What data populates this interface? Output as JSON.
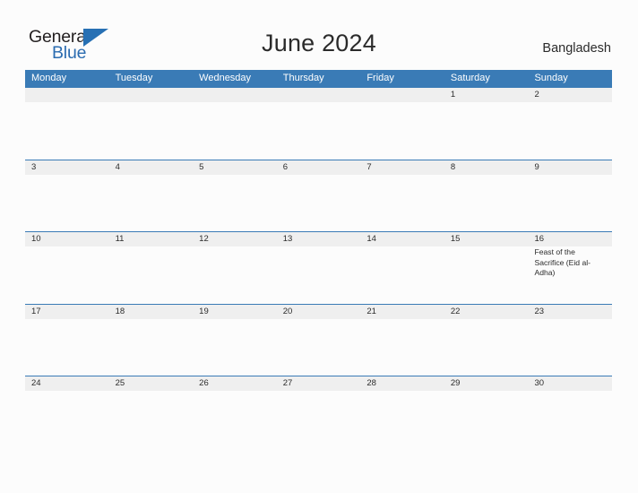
{
  "header": {
    "logo": {
      "text_primary": "General",
      "text_secondary": "Blue",
      "triangle_icon": "triangle-icon",
      "primary_color": "#231f20",
      "secondary_color": "#2b6cb0",
      "triangle_color": "#2770b4"
    },
    "title": "June 2024",
    "region": "Bangladesh"
  },
  "calendar": {
    "accent_color": "#3a7bb6",
    "date_band_color": "#efefef",
    "weekdays": [
      "Monday",
      "Tuesday",
      "Wednesday",
      "Thursday",
      "Friday",
      "Saturday",
      "Sunday"
    ],
    "weeks": [
      {
        "days": [
          {
            "date": "",
            "event": ""
          },
          {
            "date": "",
            "event": ""
          },
          {
            "date": "",
            "event": ""
          },
          {
            "date": "",
            "event": ""
          },
          {
            "date": "",
            "event": ""
          },
          {
            "date": "1",
            "event": ""
          },
          {
            "date": "2",
            "event": ""
          }
        ]
      },
      {
        "days": [
          {
            "date": "3",
            "event": ""
          },
          {
            "date": "4",
            "event": ""
          },
          {
            "date": "5",
            "event": ""
          },
          {
            "date": "6",
            "event": ""
          },
          {
            "date": "7",
            "event": ""
          },
          {
            "date": "8",
            "event": ""
          },
          {
            "date": "9",
            "event": ""
          }
        ]
      },
      {
        "days": [
          {
            "date": "10",
            "event": ""
          },
          {
            "date": "11",
            "event": ""
          },
          {
            "date": "12",
            "event": ""
          },
          {
            "date": "13",
            "event": ""
          },
          {
            "date": "14",
            "event": ""
          },
          {
            "date": "15",
            "event": ""
          },
          {
            "date": "16",
            "event": "Feast of the Sacrifice (Eid al-Adha)"
          }
        ]
      },
      {
        "days": [
          {
            "date": "17",
            "event": ""
          },
          {
            "date": "18",
            "event": ""
          },
          {
            "date": "19",
            "event": ""
          },
          {
            "date": "20",
            "event": ""
          },
          {
            "date": "21",
            "event": ""
          },
          {
            "date": "22",
            "event": ""
          },
          {
            "date": "23",
            "event": ""
          }
        ]
      },
      {
        "days": [
          {
            "date": "24",
            "event": ""
          },
          {
            "date": "25",
            "event": ""
          },
          {
            "date": "26",
            "event": ""
          },
          {
            "date": "27",
            "event": ""
          },
          {
            "date": "28",
            "event": ""
          },
          {
            "date": "29",
            "event": ""
          },
          {
            "date": "30",
            "event": ""
          }
        ]
      }
    ]
  }
}
